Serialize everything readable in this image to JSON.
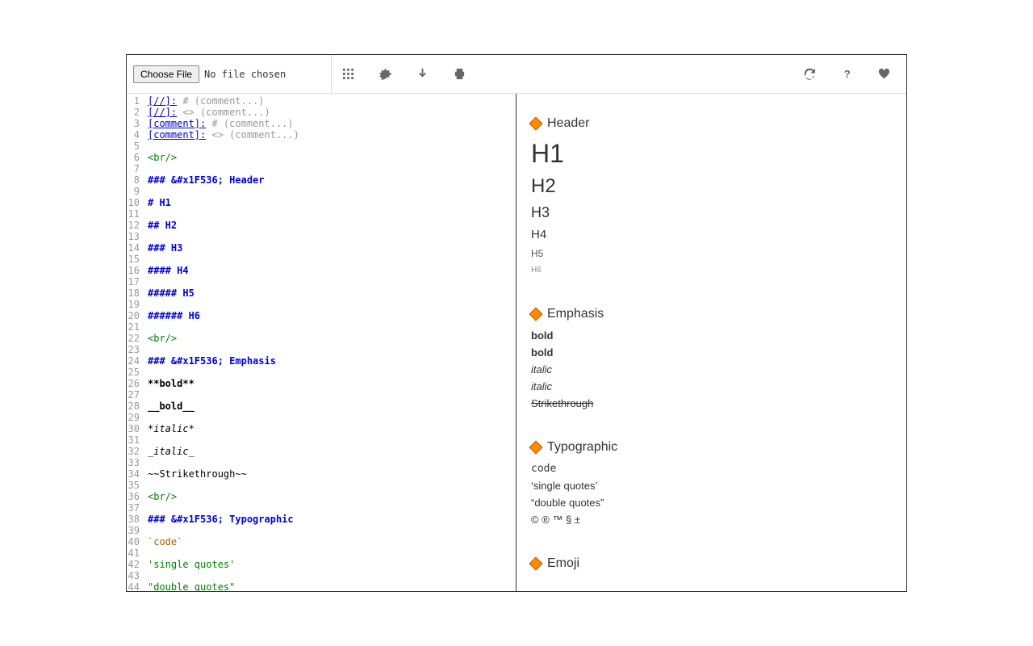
{
  "toolbar": {
    "choose_file": "Choose File",
    "no_file": "No file chosen"
  },
  "editor": {
    "lines": [
      {
        "n": 1,
        "segs": [
          {
            "cls": "tok-link",
            "t": "[//]:"
          },
          {
            "cls": "tok-comment",
            "t": " # (comment...)"
          }
        ]
      },
      {
        "n": 2,
        "segs": [
          {
            "cls": "tok-link",
            "t": "[//]:"
          },
          {
            "cls": "tok-comment",
            "t": " <> (comment...)"
          }
        ]
      },
      {
        "n": 3,
        "segs": [
          {
            "cls": "tok-link",
            "t": "[comment]:"
          },
          {
            "cls": "tok-comment",
            "t": " # (comment...)"
          }
        ]
      },
      {
        "n": 4,
        "segs": [
          {
            "cls": "tok-link",
            "t": "[comment]:"
          },
          {
            "cls": "tok-comment",
            "t": " <> (comment...)"
          }
        ]
      },
      {
        "n": 5,
        "segs": []
      },
      {
        "n": 6,
        "segs": [
          {
            "cls": "tok-tag",
            "t": "<br/>"
          }
        ]
      },
      {
        "n": 7,
        "segs": []
      },
      {
        "n": 8,
        "segs": [
          {
            "cls": "tok-header",
            "t": "### &#x1F536; Header"
          }
        ]
      },
      {
        "n": 9,
        "segs": []
      },
      {
        "n": 10,
        "segs": [
          {
            "cls": "tok-header",
            "t": "# H1"
          }
        ]
      },
      {
        "n": 11,
        "segs": []
      },
      {
        "n": 12,
        "segs": [
          {
            "cls": "tok-header",
            "t": "## H2"
          }
        ]
      },
      {
        "n": 13,
        "segs": []
      },
      {
        "n": 14,
        "segs": [
          {
            "cls": "tok-header",
            "t": "### H3"
          }
        ]
      },
      {
        "n": 15,
        "segs": []
      },
      {
        "n": 16,
        "segs": [
          {
            "cls": "tok-header",
            "t": "#### H4"
          }
        ]
      },
      {
        "n": 17,
        "segs": []
      },
      {
        "n": 18,
        "segs": [
          {
            "cls": "tok-header",
            "t": "##### H5"
          }
        ]
      },
      {
        "n": 19,
        "segs": []
      },
      {
        "n": 20,
        "segs": [
          {
            "cls": "tok-header",
            "t": "###### H6"
          }
        ]
      },
      {
        "n": 21,
        "segs": []
      },
      {
        "n": 22,
        "segs": [
          {
            "cls": "tok-tag",
            "t": "<br/>"
          }
        ]
      },
      {
        "n": 23,
        "segs": []
      },
      {
        "n": 24,
        "segs": [
          {
            "cls": "tok-header",
            "t": "### &#x1F536; Emphasis"
          }
        ]
      },
      {
        "n": 25,
        "segs": []
      },
      {
        "n": 26,
        "segs": [
          {
            "cls": "tok-bold",
            "t": "**bold**"
          }
        ]
      },
      {
        "n": 27,
        "segs": []
      },
      {
        "n": 28,
        "segs": [
          {
            "cls": "tok-bold",
            "t": "__bold__"
          }
        ]
      },
      {
        "n": 29,
        "segs": []
      },
      {
        "n": 30,
        "segs": [
          {
            "cls": "tok-em",
            "t": "*italic*"
          }
        ]
      },
      {
        "n": 31,
        "segs": []
      },
      {
        "n": 32,
        "segs": [
          {
            "cls": "tok-em",
            "t": "_italic_"
          }
        ]
      },
      {
        "n": 33,
        "segs": []
      },
      {
        "n": 34,
        "segs": [
          {
            "cls": "",
            "t": "~~Strikethrough~~"
          }
        ]
      },
      {
        "n": 35,
        "segs": []
      },
      {
        "n": 36,
        "segs": [
          {
            "cls": "tok-tag",
            "t": "<br/>"
          }
        ]
      },
      {
        "n": 37,
        "segs": []
      },
      {
        "n": 38,
        "segs": [
          {
            "cls": "tok-header",
            "t": "### &#x1F536; Typographic"
          }
        ]
      },
      {
        "n": 39,
        "segs": []
      },
      {
        "n": 40,
        "segs": [
          {
            "cls": "tok-code",
            "t": "`code`"
          }
        ]
      },
      {
        "n": 41,
        "segs": []
      },
      {
        "n": 42,
        "segs": [
          {
            "cls": "tok-quote",
            "t": "'single quotes'"
          }
        ]
      },
      {
        "n": 43,
        "segs": []
      },
      {
        "n": 44,
        "segs": [
          {
            "cls": "tok-quote",
            "t": "\"double quotes\""
          }
        ]
      }
    ]
  },
  "preview": {
    "sections": {
      "header": {
        "title": "Header",
        "h1": "H1",
        "h2": "H2",
        "h3": "H3",
        "h4": "H4",
        "h5": "H5",
        "h6": "H6"
      },
      "emphasis": {
        "title": "Emphasis",
        "bold1": "bold",
        "bold2": "bold",
        "italic1": "italic",
        "italic2": "italic",
        "strike": "Strikethrough"
      },
      "typographic": {
        "title": "Typographic",
        "code": "code",
        "single": "‘single quotes’",
        "double": "“double quotes”",
        "symbols": "© ® ™ § ±"
      },
      "emoji": {
        "title": "Emoji"
      }
    }
  }
}
